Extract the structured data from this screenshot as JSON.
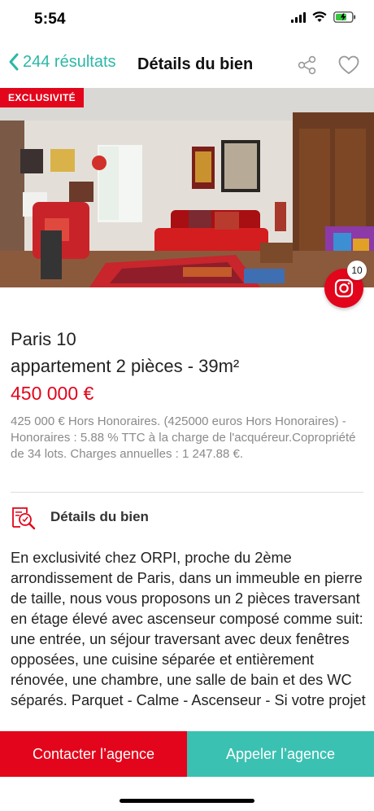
{
  "status_bar": {
    "time": "5:54",
    "icons": [
      "signal-icon",
      "wifi-icon",
      "battery-charging-icon"
    ]
  },
  "nav": {
    "back_label": "244 résultats",
    "title": "Détails du bien",
    "icons": [
      "chevron-left-icon",
      "share-icon",
      "heart-icon"
    ]
  },
  "hero": {
    "badge": "EXCLUSIVITÉ",
    "photo_count": "10",
    "icons": [
      "camera-icon"
    ]
  },
  "listing": {
    "city": "Paris 10",
    "subtitle": "appartement 2 pièces - 39m²",
    "price": "450 000 €",
    "fees": "425 000 € Hors Honoraires.  (425000 euros Hors Honoraires) - Honoraires : 5.88 % TTC à la charge de l'acquéreur.Copropriété de 34 lots. Charges annuelles : 1 247.88 €."
  },
  "details": {
    "heading": "Détails du bien",
    "icon": "property-search-icon",
    "description": "En exclusivité chez ORPI, proche du 2ème arrondissement de Paris, dans un immeuble en pierre de taille,  nous vous proposons un 2 pièces traversant en étage élevé avec ascenseur composé comme suit: une entrée, un séjour traversant avec deux fenêtres opposées, une cuisine séparée et entièrement rénovée, une chambre, une salle de bain et des WC séparés. Parquet - Calme - Ascenseur - Si votre projet"
  },
  "actions": {
    "contact": "Contacter l’agence",
    "call": "Appeler l’agence"
  },
  "colors": {
    "brand_red": "#e3051b",
    "accent_teal": "#2cb8a6",
    "call_button": "#3bc1b1"
  }
}
